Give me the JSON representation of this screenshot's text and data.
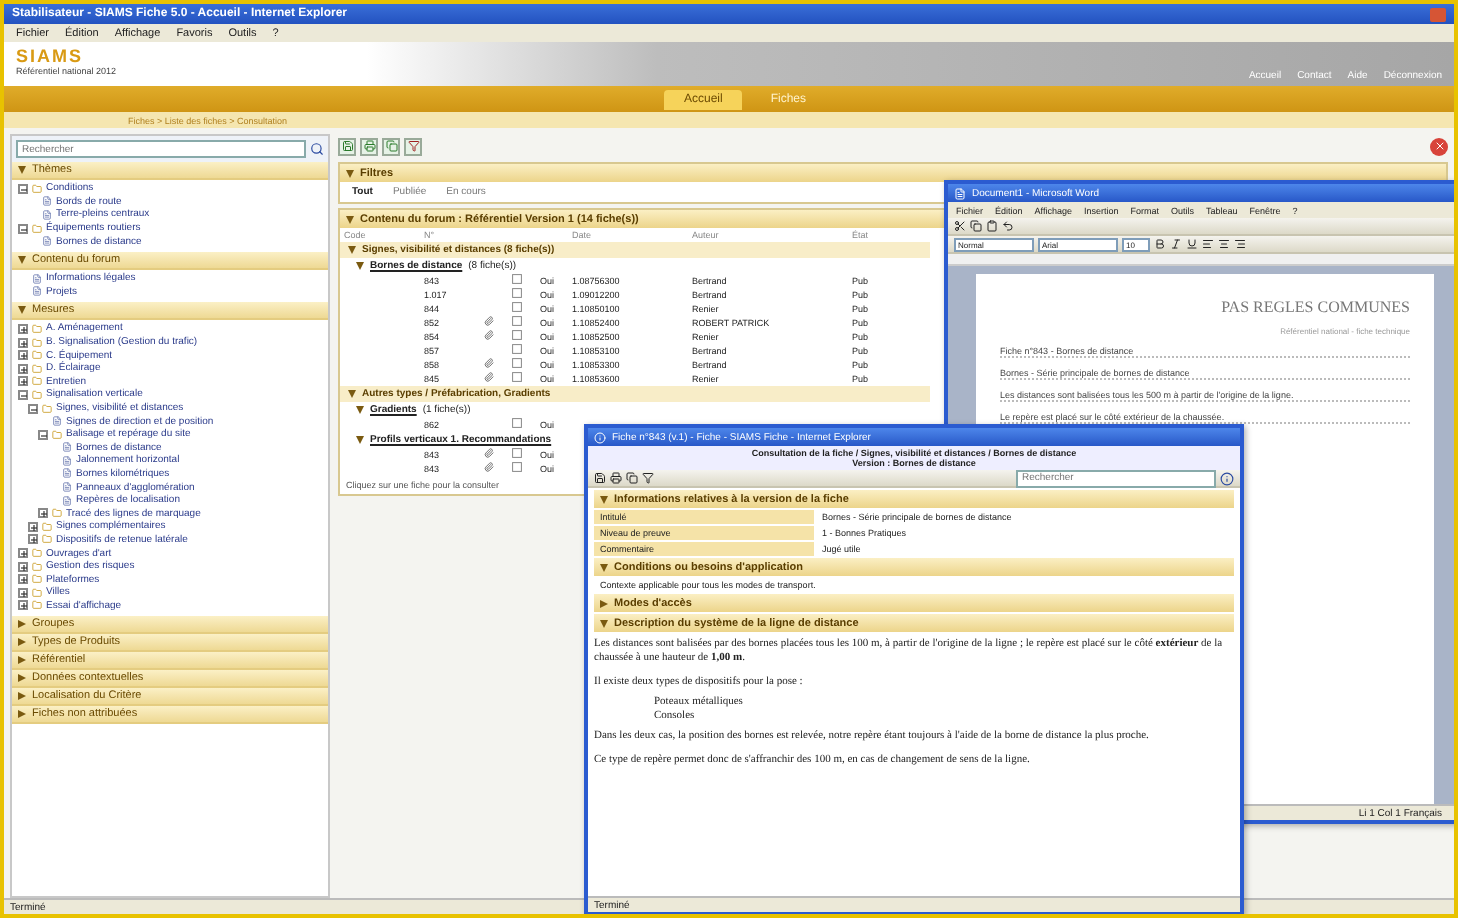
{
  "window": {
    "title": "Stabilisateur - SIAMS Fiche 5.0 - Accueil - Internet Explorer"
  },
  "menu": [
    "Fichier",
    "Édition",
    "Affichage",
    "Favoris",
    "Outils",
    "?"
  ],
  "brand": {
    "logo": "SIAMS",
    "tagline": "Référentiel national 2012"
  },
  "top_links": [
    "Accueil",
    "Contact",
    "Aide",
    "Déconnexion"
  ],
  "nav_tabs": [
    {
      "label": "Accueil",
      "selected": true
    },
    {
      "label": "Fiches",
      "selected": false
    }
  ],
  "breadcrumb": "Fiches > Liste des fiches > Consultation",
  "sidebar": {
    "search_placeholder": "Rechercher",
    "sections": [
      {
        "title": "Thèmes",
        "expanded": true,
        "items": [
          {
            "label": "Conditions",
            "expanded": true,
            "children": [
              {
                "label": "Bords de route"
              },
              {
                "label": "Terre-pleins centraux"
              }
            ]
          },
          {
            "label": "Équipements routiers",
            "expanded": true,
            "children": [
              {
                "label": "Bornes de distance"
              }
            ]
          }
        ]
      },
      {
        "title": "Contenu du forum",
        "expanded": true,
        "items": [
          {
            "label": "Informations légales"
          },
          {
            "label": "Projets"
          }
        ]
      },
      {
        "title": "Mesures",
        "expanded": true,
        "items": [
          {
            "label": "A. Aménagement",
            "expanded": false
          },
          {
            "label": "B. Signalisation (Gestion du trafic)",
            "expanded": false
          },
          {
            "label": "C. Équipement",
            "expanded": false
          },
          {
            "label": "D. Éclairage",
            "expanded": false
          },
          {
            "label": "Entretien",
            "expanded": false
          },
          {
            "label": "Signalisation verticale",
            "expanded": true,
            "children": [
              {
                "label": "Signes, visibilité et distances",
                "expanded": true,
                "children": [
                  {
                    "label": "Signes de direction et de position"
                  },
                  {
                    "label": "Balisage et repérage du site",
                    "expanded": true,
                    "children": [
                      {
                        "label": "Bornes de distance"
                      },
                      {
                        "label": "Jalonnement horizontal"
                      },
                      {
                        "label": "Bornes kilométriques"
                      },
                      {
                        "label": "Panneaux d'agglomération"
                      },
                      {
                        "label": "Repères de localisation"
                      }
                    ]
                  },
                  {
                    "label": "Tracé des lignes de marquage",
                    "expanded": false
                  }
                ]
              },
              {
                "label": "Signes complémentaires",
                "expanded": false
              },
              {
                "label": "Dispositifs de retenue latérale",
                "expanded": false
              }
            ]
          },
          {
            "label": "Ouvrages d'art",
            "expanded": false
          },
          {
            "label": "Gestion des risques",
            "expanded": false
          },
          {
            "label": "Plateformes",
            "expanded": false
          },
          {
            "label": "Villes",
            "expanded": false
          },
          {
            "label": "Essai d'affichage",
            "expanded": false
          }
        ]
      },
      {
        "title": "Groupes",
        "expanded": false
      },
      {
        "title": "Types de Produits",
        "expanded": false
      },
      {
        "title": "Référentiel",
        "expanded": false
      },
      {
        "title": "Données contextuelles",
        "expanded": false
      },
      {
        "title": "Localisation du Critère",
        "expanded": false
      },
      {
        "title": "Fiches non attribuées",
        "expanded": false
      }
    ]
  },
  "filters": {
    "title": "Filtres",
    "options": [
      {
        "label": "Tout",
        "selected": true
      },
      {
        "label": "Publiée",
        "selected": false
      },
      {
        "label": "En cours",
        "selected": false
      }
    ]
  },
  "listing": {
    "title": "Contenu du forum : Référentiel Version 1 (14 fiche(s))",
    "columns": [
      "Code",
      "N°",
      "Date",
      "Auteur",
      "État"
    ],
    "groups": [
      {
        "title": "Signes, visibilité et distances (8 fiche(s))",
        "subgroups": [
          {
            "title": "Bornes de distance",
            "count": "(8 fiche(s))",
            "rows": [
              {
                "number": "843",
                "attachment": false,
                "active": "Oui",
                "reference": "1.08756300",
                "author": "Bertrand",
                "state": "Pub"
              },
              {
                "number": "1.017",
                "attachment": false,
                "active": "Oui",
                "reference": "1.09012200",
                "author": "Bertrand",
                "state": "Pub"
              },
              {
                "number": "844",
                "attachment": false,
                "active": "Oui",
                "reference": "1.10850100",
                "author": "Renier",
                "state": "Pub"
              },
              {
                "number": "852",
                "attachment": true,
                "active": "Oui",
                "reference": "1.10852400",
                "author": "ROBERT PATRICK",
                "state": "Pub"
              },
              {
                "number": "854",
                "attachment": true,
                "active": "Oui",
                "reference": "1.10852500",
                "author": "Renier",
                "state": "Pub"
              },
              {
                "number": "857",
                "attachment": false,
                "active": "Oui",
                "reference": "1.10853100",
                "author": "Bertrand",
                "state": "Pub"
              },
              {
                "number": "858",
                "attachment": true,
                "active": "Oui",
                "reference": "1.10853300",
                "author": "Bertrand",
                "state": "Pub"
              },
              {
                "number": "845",
                "attachment": true,
                "active": "Oui",
                "reference": "1.10853600",
                "author": "Renier",
                "state": "Pub"
              }
            ]
          }
        ]
      },
      {
        "title": "Autres types / Préfabrication, Gradients",
        "subgroups": [
          {
            "title": "Gradients",
            "count": "(1 fiche(s))",
            "rows": [
              {
                "number": "862",
                "attachment": false,
                "active": "Oui"
              }
            ]
          },
          {
            "title": "Profils verticaux 1. Recommandations",
            "rows": [
              {
                "number": "843",
                "attachment": true,
                "active": "Oui"
              },
              {
                "number": "843",
                "attachment": true,
                "active": "Oui"
              }
            ]
          }
        ]
      }
    ],
    "footer": "Cliquez sur une fiche pour la consulter"
  },
  "word": {
    "title": "Document1 - Microsoft Word",
    "menu": [
      "Fichier",
      "Édition",
      "Affichage",
      "Insertion",
      "Format",
      "Outils",
      "Tableau",
      "Fenêtre",
      "?"
    ],
    "style": "Normal",
    "font": "Arial",
    "size": "10",
    "heading": "PAS REGLES COMMUNES",
    "subheading": "Référentiel national - fiche technique",
    "lines": [
      "Fiche n°843 - Bornes de distance",
      "Bornes - Série principale de bornes de distance",
      "Les distances sont balisées tous les 500 m à partir de l'origine de la ligne.",
      "Le repère est placé sur le côté extérieur de la chaussée."
    ],
    "status": "Li 1  Col 1  Français"
  },
  "dialog": {
    "title": "Fiche n°843 (v.1) - Fiche - SIAMS Fiche - Internet Explorer",
    "path": "Consultation de la fiche / Signes, visibilité et distances / Bornes de distance",
    "version": "Version : Bornes de distance",
    "search_placeholder": "Rechercher",
    "info_title": "Informations relatives à la version de la fiche",
    "info_rows": [
      {
        "label": "Intitulé",
        "value": "Bornes - Série principale de bornes de distance"
      },
      {
        "label": "Niveau de preuve",
        "value": "1 - Bonnes Pratiques"
      },
      {
        "label": "Commentaire",
        "value": "Jugé utile"
      }
    ],
    "sections": [
      {
        "title": "Conditions ou besoins d'application",
        "expanded": true,
        "text": "Contexte applicable pour tous les modes de transport."
      },
      {
        "title": "Modes d'accès",
        "expanded": false
      },
      {
        "title": "Description du système de la ligne de distance",
        "expanded": true
      }
    ],
    "paragraphs": [
      "Les distances sont balisées par des bornes placées tous les 100 m, à partir de l'origine de la ligne ; le repère est placé sur le côté **extérieur** de la chaussée à une hauteur de **1,00 m**.",
      "Il existe deux types de dispositifs pour la pose :"
    ],
    "bullets": [
      "Poteaux métalliques",
      "Consoles"
    ],
    "paragraphs_after": [
      "Dans les deux cas, la position des bornes est relevée, notre repère étant toujours à l'aide de la borne de distance la plus proche.",
      "Ce type de repère permet donc de s'affranchir des 100 m, en cas de changement de sens de la ligne."
    ],
    "status": "Terminé"
  },
  "status_bar": "Terminé"
}
